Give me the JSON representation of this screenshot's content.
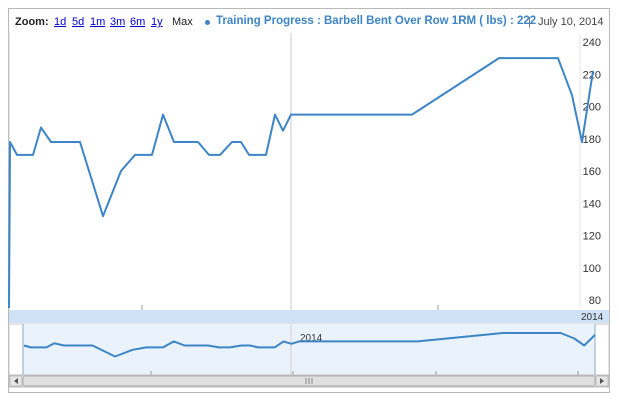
{
  "header": {
    "zoom_label": "Zoom:",
    "zoom_options": [
      "1d",
      "5d",
      "1m",
      "3m",
      "6m",
      "1y"
    ],
    "zoom_active": "Max",
    "legend_text": "Training Progress : Barbell Bent Over Row 1RM ( lbs) : 222",
    "legend_date": "July 10, 2014",
    "separator": "|"
  },
  "colors": {
    "line": "#3d85c6",
    "range_band": "#cfe2f5",
    "navigator_fill": "#eaf3fb"
  },
  "range_bar": {
    "label": "2014"
  },
  "navigator": {
    "label": "2014"
  },
  "chart_data": {
    "type": "line",
    "ylim": [
      75,
      240
    ],
    "y_ticks": [
      80,
      100,
      120,
      140,
      160,
      180,
      200,
      220,
      240
    ],
    "grid": false,
    "series": [
      {
        "name": "Training Progress : Barbell Bent Over Row 1RM ( lbs)",
        "x": [
          0,
          1,
          8,
          15,
          24,
          32,
          42,
          53,
          71,
          94,
          112,
          126,
          134,
          143,
          154,
          165,
          175,
          189,
          200,
          211,
          223,
          232,
          240,
          250,
          257,
          266,
          274,
          282,
          291,
          305,
          316,
          326,
          333,
          340,
          365,
          388,
          403,
          490,
          549,
          563,
          573,
          584
        ],
        "y": [
          75,
          178,
          170,
          170,
          170,
          187,
          178,
          178,
          178,
          132,
          160,
          170,
          170,
          170,
          195,
          178,
          178,
          178,
          170,
          170,
          178,
          178,
          170,
          170,
          170,
          195,
          185,
          195,
          195,
          195,
          195,
          195,
          195,
          195,
          195,
          195,
          195,
          230,
          230,
          207,
          178,
          222
        ]
      }
    ]
  }
}
